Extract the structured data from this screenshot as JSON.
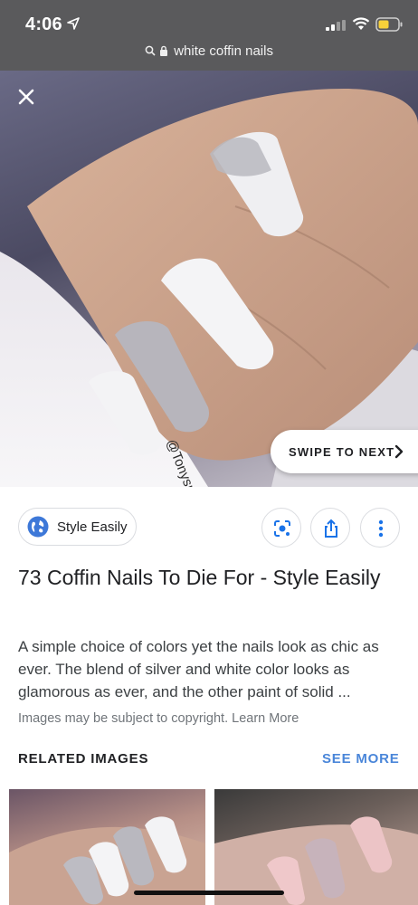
{
  "status_bar": {
    "time": "4:06"
  },
  "address_bar": {
    "url_text": "white coffin nails"
  },
  "hero": {
    "watermark": "@Tonysnail",
    "swipe_label": "SWIPE TO NEXT"
  },
  "result": {
    "source_name": "Style Easily",
    "title": "73 Coffin Nails To Die For - Style Easily",
    "description": "A simple choice of colors yet the nails look as chic as ever. The blend of silver and white color looks as glamorous as ever, and the other paint of solid ...",
    "copyright_prefix": "Images may be subject to copyright.",
    "learn_more": "Learn More"
  },
  "related": {
    "heading": "RELATED IMAGES",
    "see_more": "SEE MORE"
  },
  "colors": {
    "accent": "#4a86d9",
    "top_bar": "#5a5a5c",
    "text": "#202124"
  },
  "icons": [
    "location-arrow-icon",
    "signal-icon",
    "wifi-icon",
    "battery-icon",
    "search-icon",
    "lock-icon",
    "close-icon",
    "chevron-right-icon",
    "globe-icon",
    "lens-icon",
    "share-icon",
    "more-vertical-icon"
  ]
}
